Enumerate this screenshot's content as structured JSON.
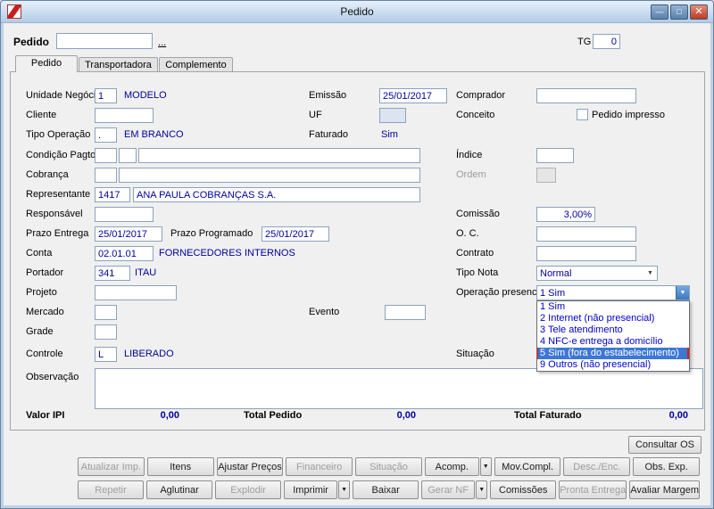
{
  "colors": {
    "navy_value_text": "#00009b",
    "dropdown_item_text": "#0000cc",
    "highlight_blue": "#3c77d6",
    "annotation_red": "#e01b14",
    "titlebar_blue": "#b2cbe6"
  },
  "icons": {
    "dropdown": "▼",
    "minimize": "—",
    "maximize": "□",
    "close": "✕"
  },
  "window": {
    "title": "Pedido"
  },
  "header": {
    "label": "Pedido",
    "value": "",
    "browse": "...",
    "tg_label": "TG",
    "tg_value": "0"
  },
  "tabs": [
    {
      "label": "Pedido"
    },
    {
      "label": "Transportadora"
    },
    {
      "label": "Complemento"
    }
  ],
  "fields": {
    "unidade_negocio": {
      "label": "Unidade Negócio",
      "code": "1",
      "desc": "MODELO"
    },
    "cliente": {
      "label": "Cliente",
      "value": ""
    },
    "tipo_operacao": {
      "label": "Tipo Operação",
      "code": ".",
      "desc": "EM BRANCO"
    },
    "condicao_pagto": {
      "label": "Condição Pagto.",
      "code": "",
      "code2": "",
      "desc": ""
    },
    "cobranca": {
      "label": "Cobrança",
      "code": "",
      "desc": ""
    },
    "representante": {
      "label": "Representante",
      "code": "1417",
      "desc": "ANA PAULA COBRANÇAS S.A."
    },
    "responsavel": {
      "label": "Responsável",
      "value": ""
    },
    "prazo_entrega": {
      "label": "Prazo Entrega",
      "value": "25/01/2017"
    },
    "prazo_programado": {
      "label": "Prazo Programado",
      "value": "25/01/2017"
    },
    "conta": {
      "label": "Conta",
      "code": "02.01.01",
      "desc": "FORNECEDORES INTERNOS"
    },
    "portador": {
      "label": "Portador",
      "code": "341",
      "desc": "ITAU"
    },
    "projeto": {
      "label": "Projeto",
      "value": ""
    },
    "mercado": {
      "label": "Mercado",
      "value": ""
    },
    "evento": {
      "label": "Evento",
      "value": ""
    },
    "grade": {
      "label": "Grade",
      "value": ""
    },
    "controle": {
      "label": "Controle",
      "code": "L",
      "desc": "LIBERADO"
    },
    "observacao": {
      "label": "Observação",
      "value": ""
    },
    "emissao": {
      "label": "Emissão",
      "value": "25/01/2017"
    },
    "uf": {
      "label": "UF",
      "value": ""
    },
    "faturado": {
      "label": "Faturado",
      "value": "Sim"
    },
    "comprador": {
      "label": "Comprador",
      "value": ""
    },
    "conceito": {
      "label": "Conceito",
      "checkbox_label": "Pedido impresso",
      "checked": false
    },
    "indice": {
      "label": "Índice",
      "value": ""
    },
    "ordem": {
      "label": "Ordem",
      "value": ""
    },
    "comissao": {
      "label": "Comissão",
      "value": "3,00%"
    },
    "oc": {
      "label": "O. C.",
      "value": ""
    },
    "contrato": {
      "label": "Contrato",
      "value": ""
    },
    "tipo_nota": {
      "label": "Tipo Nota",
      "value": "Normal"
    },
    "operacao_presencial": {
      "label": "Operação presencial",
      "value": "1 Sim",
      "options": [
        "1 Sim",
        "2 Internet (não presencial)",
        "3 Tele atendimento",
        "4 NFC-e entrega a domicílio",
        "5 Sim (fora do estabelecimento)",
        "9 Outros (não presencial)"
      ],
      "highlighted_index": 4
    },
    "situacao": {
      "label": "Situação"
    }
  },
  "totals": {
    "valor_ipi_label": "Valor IPI",
    "valor_ipi": "0,00",
    "total_pedido_label": "Total Pedido",
    "total_pedido": "0,00",
    "total_faturado_label": "Total Faturado",
    "total_faturado": "0,00"
  },
  "footer": {
    "consultar_os": "Consultar OS",
    "row1": [
      {
        "label": "Atualizar Imp.",
        "disabled": true
      },
      {
        "label": "Itens",
        "disabled": false
      },
      {
        "label": "Ajustar Preços",
        "disabled": false
      },
      {
        "label": "Financeiro",
        "disabled": true
      },
      {
        "label": "Situação",
        "disabled": true
      },
      {
        "label": "Acomp.",
        "disabled": false,
        "split": true
      },
      {
        "label": "Mov.Compl.",
        "disabled": false
      },
      {
        "label": "Desc./Enc.",
        "disabled": true
      },
      {
        "label": "Obs. Exp.",
        "disabled": false
      }
    ],
    "row2": [
      {
        "label": "Repetir",
        "disabled": true
      },
      {
        "label": "Aglutinar",
        "disabled": false
      },
      {
        "label": "Explodir",
        "disabled": true
      },
      {
        "label": "Imprimir",
        "disabled": false,
        "split": true
      },
      {
        "label": "Baixar",
        "disabled": false
      },
      {
        "label": "Gerar NF",
        "disabled": true,
        "split": true
      },
      {
        "label": "Comissões",
        "disabled": false
      },
      {
        "label": "Pronta Entrega",
        "disabled": true
      },
      {
        "label": "Avaliar Margem",
        "disabled": false
      }
    ]
  }
}
